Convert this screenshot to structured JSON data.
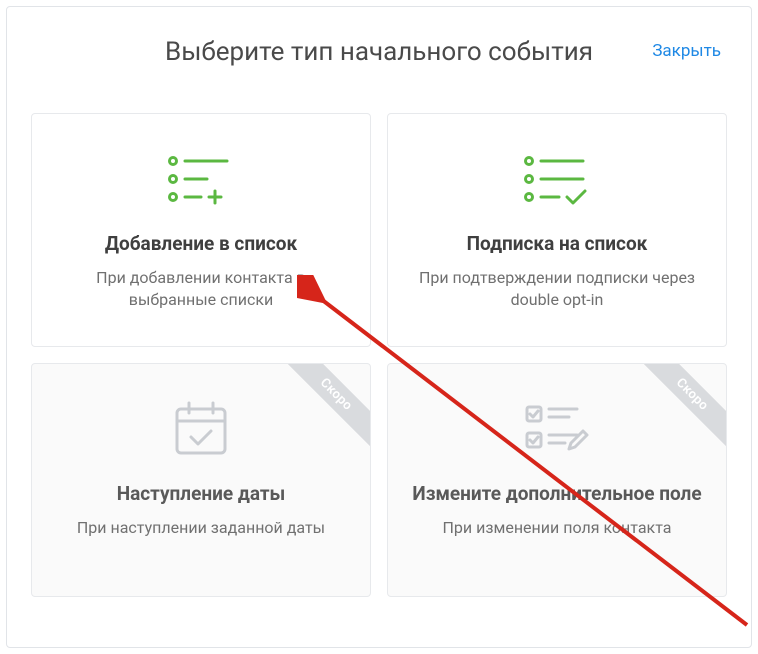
{
  "modal": {
    "title": "Выберите тип начального события",
    "close_label": "Закрыть"
  },
  "ribbon_label": "Скоро",
  "cards": [
    {
      "id": "add-to-list",
      "title": "Добавление в список",
      "desc": "При добавлении контакта в выбранные списки",
      "disabled": false
    },
    {
      "id": "subscribe-list",
      "title": "Подписка на список",
      "desc": "При подтверждении подписки через double opt-in",
      "disabled": false
    },
    {
      "id": "date-reached",
      "title": "Наступление даты",
      "desc": "При наступлении заданной даты",
      "disabled": true
    },
    {
      "id": "field-change",
      "title": "Измените дополнительное поле",
      "desc": "При изменении поля контакта",
      "disabled": true
    }
  ],
  "colors": {
    "active_icon": "#5bb841",
    "disabled_icon": "#c9ccd1",
    "link": "#1e88e5",
    "arrow": "#d6251a"
  }
}
